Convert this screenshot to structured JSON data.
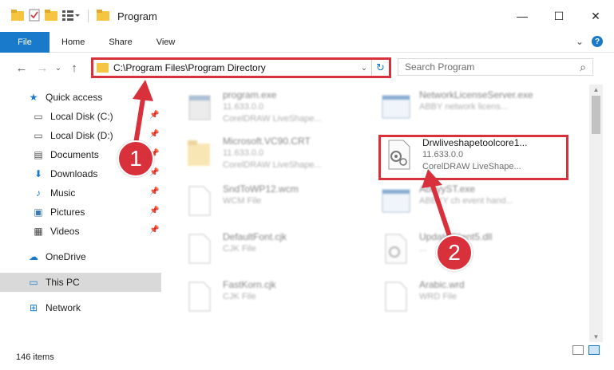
{
  "window": {
    "title": "Program",
    "minimize": "—",
    "maximize": "☐",
    "close": "✕"
  },
  "ribbon": {
    "tabs": [
      "File",
      "Home",
      "Share",
      "View"
    ],
    "collapse": "⌄",
    "help": "?"
  },
  "navbar": {
    "back": "←",
    "forward": "→",
    "recent": "⌄",
    "up": "↑",
    "path": "C:\\Program Files\\Program Directory",
    "dropdown": "⌄",
    "refresh": "↻",
    "search_placeholder": "Search Program",
    "search_icon": "⌕"
  },
  "sidebar": {
    "quick_access": "Quick access",
    "items": [
      {
        "label": "Local Disk (C:)",
        "icon": "disk-icon",
        "glyph": "▭"
      },
      {
        "label": "Local Disk (D:)",
        "icon": "disk-icon",
        "glyph": "▭"
      },
      {
        "label": "Documents",
        "icon": "documents-icon",
        "glyph": "▤"
      },
      {
        "label": "Downloads",
        "icon": "downloads-icon",
        "glyph": "⬇"
      },
      {
        "label": "Music",
        "icon": "music-icon",
        "glyph": "♪"
      },
      {
        "label": "Pictures",
        "icon": "pictures-icon",
        "glyph": "▣"
      },
      {
        "label": "Videos",
        "icon": "videos-icon",
        "glyph": "▦"
      }
    ],
    "onedrive": "OneDrive",
    "this_pc": "This PC",
    "network": "Network",
    "pin": "📌"
  },
  "files": [
    {
      "name": "program.exe",
      "line2": "11.633.0.0",
      "line3": "CorelDRAW LiveShape...",
      "blurred": true
    },
    {
      "name": "NetworkLicenseServer.exe",
      "line2": "ABBY network licens...",
      "line3": "",
      "blurred": true
    },
    {
      "name": "Microsoft.VC90.CRT",
      "line2": "11.633.0.0",
      "line3": "CorelDRAW LiveShape...",
      "blurred": true
    },
    {
      "name": "Drwliveshapetoolcore1...",
      "line2": "11.633.0.0",
      "line3": "CorelDRAW LiveShape...",
      "blurred": false
    },
    {
      "name": "SndToWP12.wcm",
      "line2": "WCM File",
      "line3": "",
      "blurred": true
    },
    {
      "name": "AbbyyST.exe",
      "line2": "ABBYY ch event hand...",
      "line3": "",
      "blurred": true
    },
    {
      "name": "DefaultFont.cjk",
      "line2": "CJK File",
      "line3": "",
      "blurred": true
    },
    {
      "name": "UpdateClient5.dll",
      "line2": "...",
      "line3": "",
      "blurred": true
    },
    {
      "name": "FastKorn.cjk",
      "line2": "CJK File",
      "line3": "",
      "blurred": true
    },
    {
      "name": "Arabic.wrd",
      "line2": "WRD File",
      "line3": "",
      "blurred": true
    }
  ],
  "status": {
    "count": "146 items"
  },
  "badges": {
    "one": "1",
    "two": "2"
  },
  "colors": {
    "accent": "#1979ca",
    "highlight": "#d9313b"
  }
}
